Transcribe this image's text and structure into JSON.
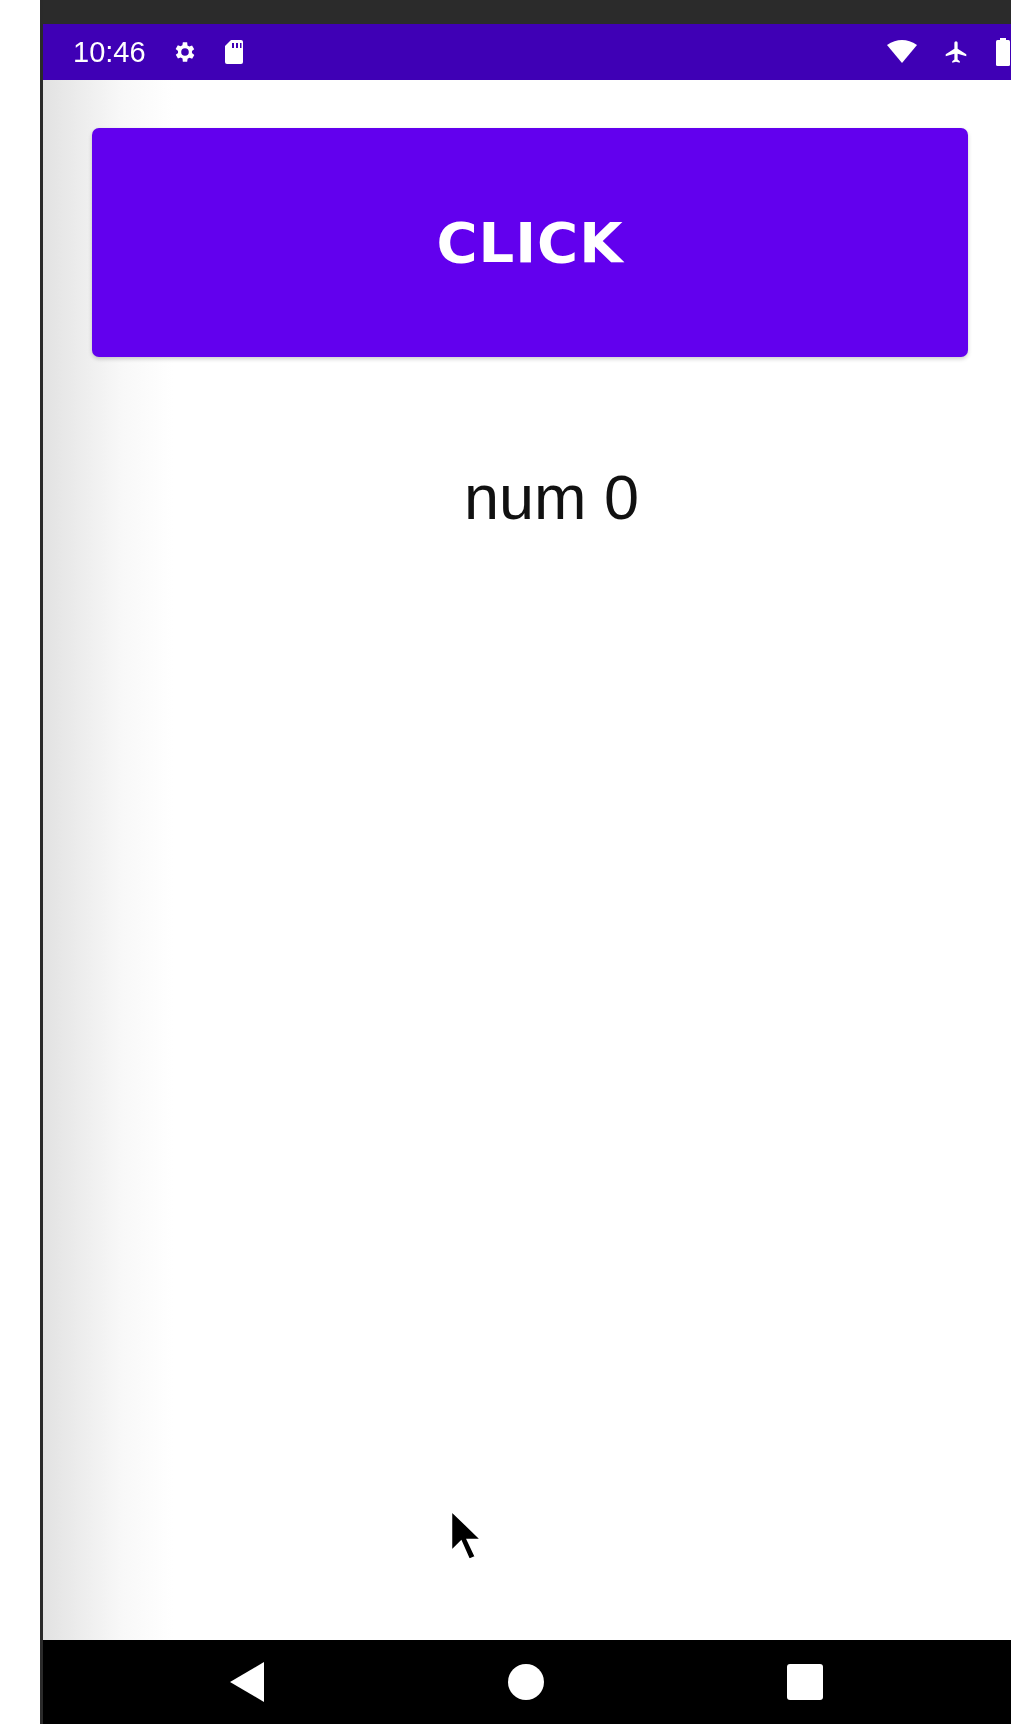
{
  "status_bar": {
    "time": "10:46"
  },
  "button": {
    "label": "CLICK"
  },
  "counter": {
    "text": "num 0"
  }
}
